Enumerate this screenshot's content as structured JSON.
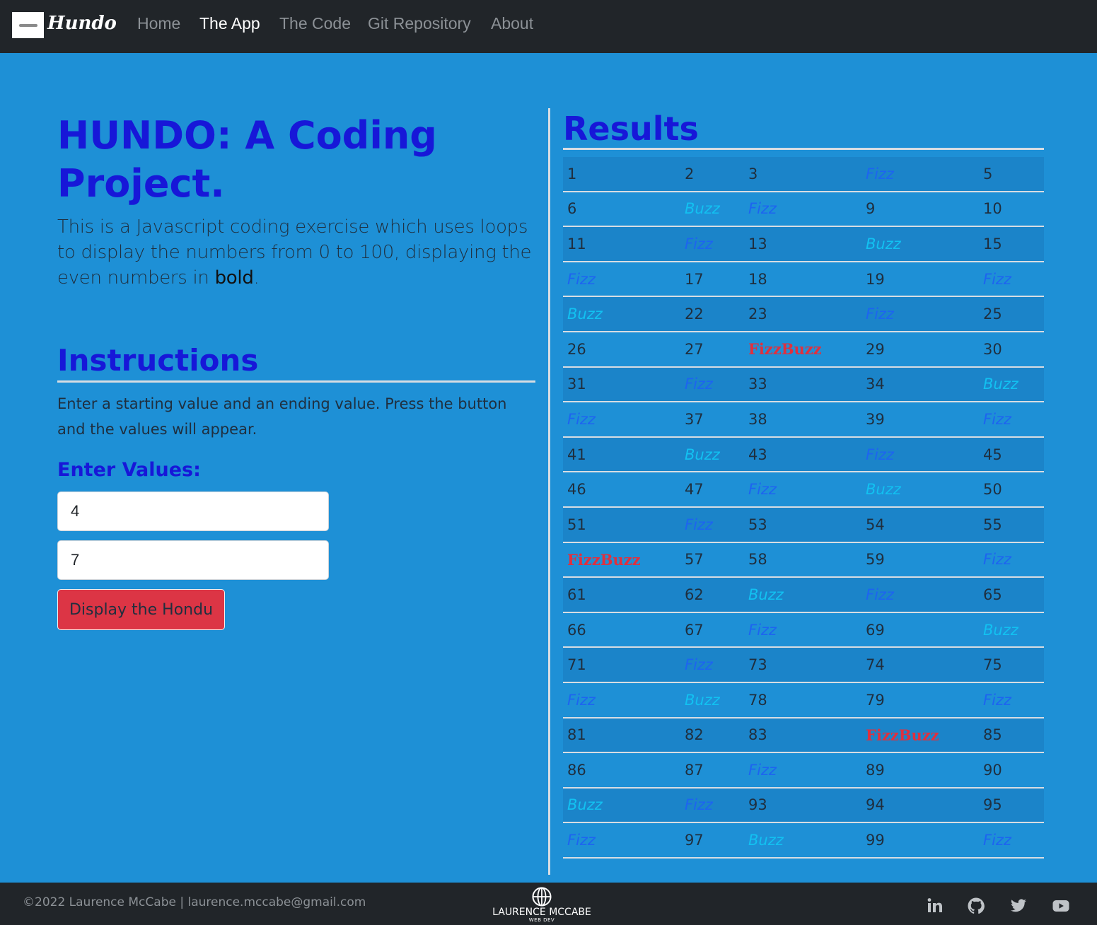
{
  "brand": {
    "name": "Hundo"
  },
  "nav": [
    {
      "label": "Home",
      "active": false
    },
    {
      "label": "The App",
      "active": true
    },
    {
      "label": "The Code",
      "active": false
    },
    {
      "label": "Git Repository",
      "active": false
    },
    {
      "label": "About",
      "active": false
    }
  ],
  "intro": {
    "title": "HUNDO: A Coding Project.",
    "lead_start": "This is a Javascript coding exercise which uses loops to display the numbers from 0 to 100, displaying the even numbers in ",
    "lead_bold": "bold",
    "lead_end": "."
  },
  "instructions": {
    "heading": "Instructions",
    "text": "Enter a starting value and an ending value. Press the button and the values will appear."
  },
  "form": {
    "label": "Enter Values:",
    "start_value": "4",
    "end_value": "7",
    "button_label": "Display the Hondu"
  },
  "results": {
    "heading": "Results",
    "rows": [
      [
        "1",
        "2",
        "3",
        "Fizz",
        "5"
      ],
      [
        "6",
        "Buzz",
        "Fizz",
        "9",
        "10"
      ],
      [
        "11",
        "Fizz",
        "13",
        "Buzz",
        "15"
      ],
      [
        "Fizz",
        "17",
        "18",
        "19",
        "Fizz"
      ],
      [
        "Buzz",
        "22",
        "23",
        "Fizz",
        "25"
      ],
      [
        "26",
        "27",
        "FizzBuzz",
        "29",
        "30"
      ],
      [
        "31",
        "Fizz",
        "33",
        "34",
        "Buzz"
      ],
      [
        "Fizz",
        "37",
        "38",
        "39",
        "Fizz"
      ],
      [
        "41",
        "Buzz",
        "43",
        "Fizz",
        "45"
      ],
      [
        "46",
        "47",
        "Fizz",
        "Buzz",
        "50"
      ],
      [
        "51",
        "Fizz",
        "53",
        "54",
        "55"
      ],
      [
        "FizzBuzz",
        "57",
        "58",
        "59",
        "Fizz"
      ],
      [
        "61",
        "62",
        "Buzz",
        "Fizz",
        "65"
      ],
      [
        "66",
        "67",
        "Fizz",
        "69",
        "Buzz"
      ],
      [
        "71",
        "Fizz",
        "73",
        "74",
        "75"
      ],
      [
        "Fizz",
        "Buzz",
        "78",
        "79",
        "Fizz"
      ],
      [
        "81",
        "82",
        "83",
        "FizzBuzz",
        "85"
      ],
      [
        "86",
        "87",
        "Fizz",
        "89",
        "90"
      ],
      [
        "Buzz",
        "Fizz",
        "93",
        "94",
        "95"
      ],
      [
        "Fizz",
        "97",
        "Buzz",
        "99",
        "Fizz"
      ]
    ]
  },
  "footer": {
    "copyright": "©2022 Laurence McCabe | laurence.mccabe@gmail.com",
    "logo_name": "LAURENCE MCCABE",
    "logo_sub": "WEB DEV",
    "social": [
      "linkedin-icon",
      "github-icon",
      "twitter-icon",
      "youtube-icon"
    ]
  },
  "colors": {
    "navbar": "#212529",
    "page_bg": "#1e90d6",
    "heading": "#1717d8",
    "fizz": "#1d64f0",
    "buzz": "#12c1f1",
    "fizzbuzz": "#e0303e",
    "button": "#dc3545"
  }
}
